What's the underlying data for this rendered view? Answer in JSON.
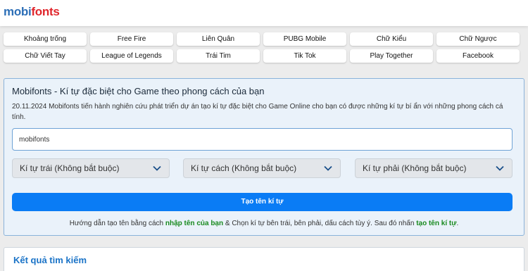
{
  "logo": {
    "part1": "mobi",
    "part2": "fonts"
  },
  "nav_buttons": [
    "Khoảng trống",
    "Free Fire",
    "Liên Quân",
    "PUBG Mobile",
    "Chữ Kiểu",
    "Chữ Ngược",
    "Chữ Viết Tay",
    "League of Legends",
    "Trái Tim",
    "Tik Tok",
    "Play Together",
    "Facebook"
  ],
  "panel": {
    "title": "Mobifonts - Kí tự đặc biệt cho Game theo phong cách của bạn",
    "description": "20.11.2024 Mobifonts tiến hành nghiên cứu phát triển dự án tạo kí tự đặc biệt cho Game Online cho bạn có được những kí tự bí ẩn với những phong cách cá tính.",
    "input_value": "mobifonts",
    "select_left": "Kí tự trái (Không bắt buộc)",
    "select_mid": "Kí tự cách (Không bắt buộc)",
    "select_right": "Kí tự phải (Không bắt buộc)",
    "submit_label": "Tạo tên kí tự",
    "guide": {
      "part1": "Hướng dẫn tạo tên bằng cách ",
      "highlight1": "nhập tên của bạn",
      "part2": " & Chọn kí tự bên trái, bên phải, dấu cách tùy ý. Sau đó nhấn ",
      "highlight2": "tạo tên kí tự",
      "part3": "."
    }
  },
  "result": {
    "title": "Kết quả tìm kiếm"
  },
  "colors": {
    "accent": "#0a7cf5",
    "logo_blue": "#2d6fb7",
    "logo_red": "#e0262c",
    "highlight_green": "#198a1f"
  }
}
